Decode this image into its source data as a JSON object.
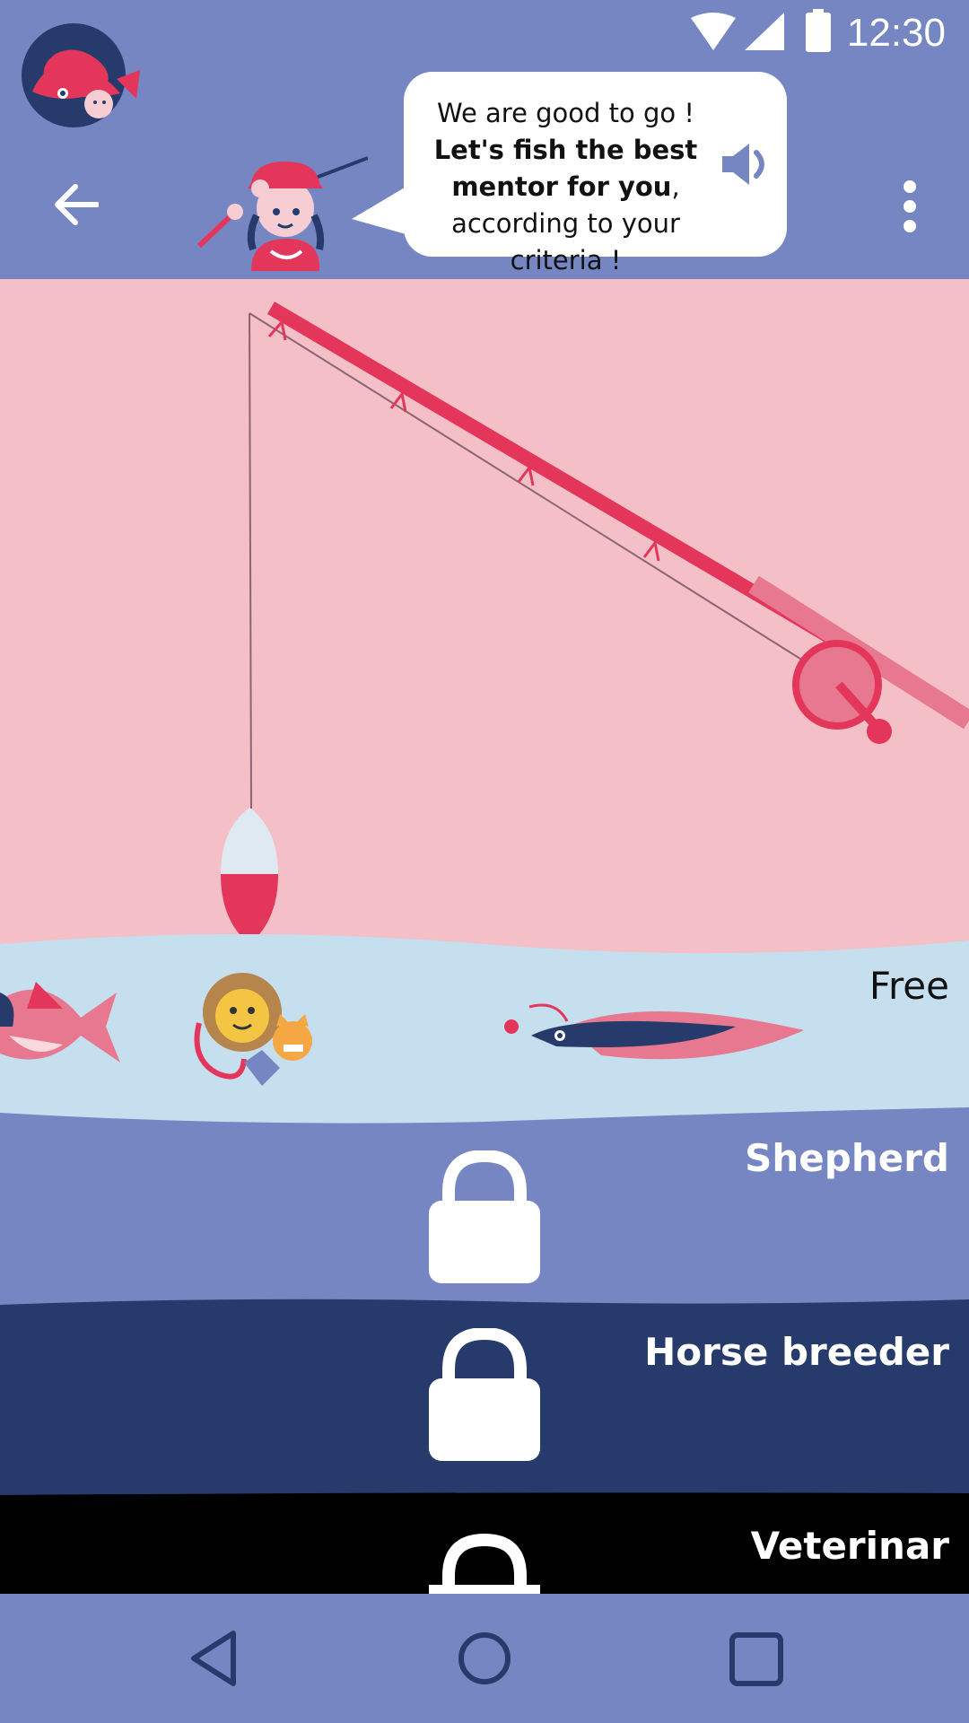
{
  "status_bar": {
    "time": "12:30"
  },
  "header": {
    "speech": {
      "part1": "We are good to go ! ",
      "bold": "Let's fish the best mentor for you",
      "part2": ", according to your criteria !"
    }
  },
  "levels": [
    {
      "label": "Free",
      "locked": false
    },
    {
      "label": "Shepherd",
      "locked": true
    },
    {
      "label": "Horse breeder",
      "locked": true
    },
    {
      "label": "Veterinar",
      "locked": true
    }
  ],
  "colors": {
    "header_bg": "#7586c2",
    "sky_pink": "#f4bfc6",
    "water_light": "#c5dfee",
    "band_mid": "#7586c2",
    "band_dark": "#263a6b",
    "band_black": "#000000",
    "accent_red": "#e3365a"
  }
}
